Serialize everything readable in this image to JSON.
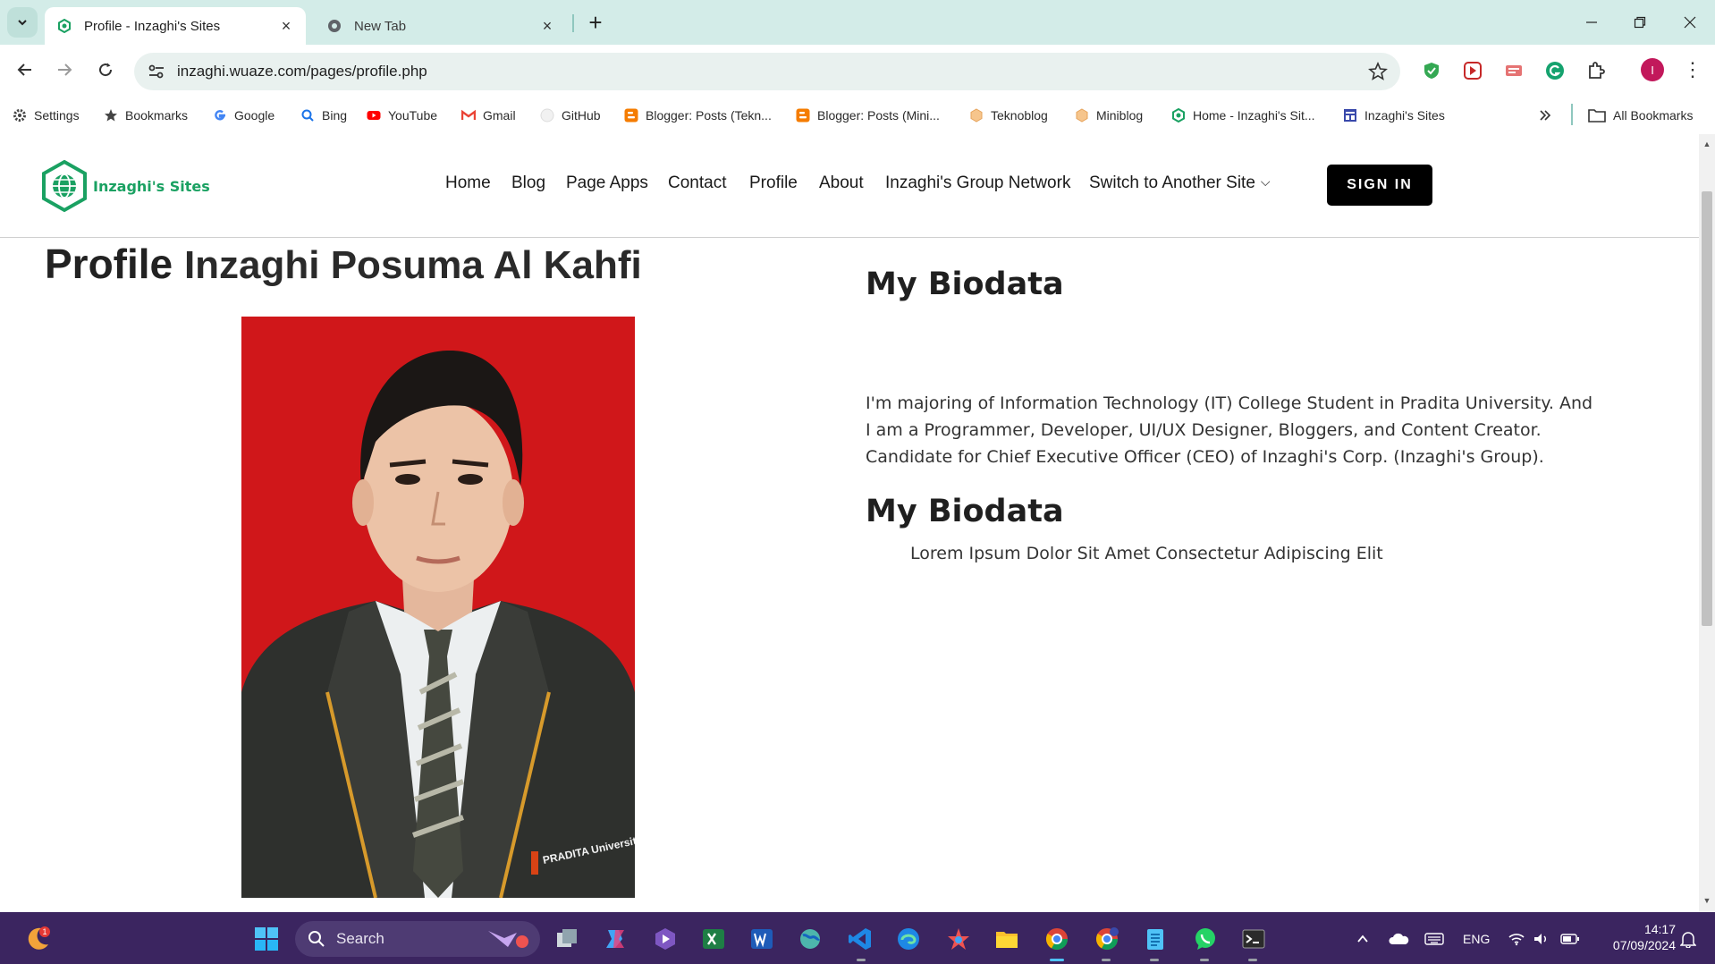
{
  "browser": {
    "tabs": [
      {
        "title": "Profile - Inzaghi's Sites",
        "active": true
      },
      {
        "title": "New Tab",
        "active": false
      }
    ],
    "url": "inzaghi.wuaze.com/pages/profile.php",
    "profile_initial": "I",
    "bookmarks": [
      {
        "label": "Settings",
        "icon": "gear-icon"
      },
      {
        "label": "Bookmarks",
        "icon": "star-icon"
      },
      {
        "label": "Google",
        "icon": "google-icon"
      },
      {
        "label": "Bing",
        "icon": "bing-icon"
      },
      {
        "label": "YouTube",
        "icon": "youtube-icon"
      },
      {
        "label": "Gmail",
        "icon": "gmail-icon"
      },
      {
        "label": "GitHub",
        "icon": "github-icon"
      },
      {
        "label": "Blogger: Posts (Tekn...",
        "icon": "blogger-icon"
      },
      {
        "label": "Blogger: Posts (Mini...",
        "icon": "blogger-icon"
      },
      {
        "label": "Teknoblog",
        "icon": "hexagon-icon"
      },
      {
        "label": "Miniblog",
        "icon": "hexagon-icon"
      },
      {
        "label": "Home - Inzaghi's Sit...",
        "icon": "site-icon"
      },
      {
        "label": "Inzaghi's Sites",
        "icon": "site-layout-icon"
      }
    ],
    "all_bookmarks": "All Bookmarks"
  },
  "site": {
    "logo_text": "Inzaghi's Sites",
    "nav": [
      "Home",
      "Blog",
      "Page Apps",
      "Contact",
      "Profile",
      "About",
      "Inzaghi's Group Network",
      "Switch to Another Site"
    ],
    "sign_in": "SIGN IN"
  },
  "profile": {
    "heading_strong": "Profile",
    "heading_name": "Inzaghi Posuma Al Kahfi",
    "bio_title_1": "My Biodata",
    "bio_text": "I'm majoring of Information Technology (IT) College Student in Pradita University. And I am a Programmer, Developer, UI/UX Designer, Bloggers, and Content Creator. Candidate for Chief Executive Officer (CEO) of Inzaghi's Corp. (Inzaghi's Group).",
    "bio_title_2": "My Biodata",
    "bio_list_item": "Lorem Ipsum Dolor Sit Amet Consectetur Adipiscing Elit",
    "badge_text": "PRADITA University"
  },
  "taskbar": {
    "search_label": "Search",
    "notification_count": "1",
    "language": "ENG",
    "time": "14:17",
    "date": "07/09/2024"
  },
  "colors": {
    "tabstrip": "#d3ece8",
    "brand_green": "#1aa162",
    "photo_background": "#d0171a",
    "taskbar": "#3b2560"
  }
}
